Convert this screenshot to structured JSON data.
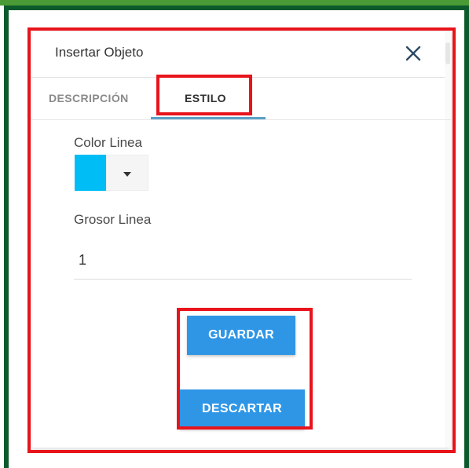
{
  "dialog": {
    "title": "Insertar Objeto"
  },
  "tabs": [
    {
      "label": "DESCRIPCIÓN",
      "active": false
    },
    {
      "label": "ESTILO",
      "active": true
    }
  ],
  "style_form": {
    "color_label": "Color Linea",
    "color_value": "#00bdf5",
    "thickness_label": "Grosor Linea",
    "thickness_value": "1"
  },
  "buttons": {
    "save_label": "GUARDAR",
    "discard_label": "DESCARTAR"
  },
  "colors": {
    "accent": "#2f96e6",
    "highlight": "#e8141c",
    "frame_green": "#0c5a2c",
    "stripe_green": "#4a9a35"
  },
  "icons": {
    "close": "close-icon",
    "dropdown": "chevron-down-icon"
  }
}
